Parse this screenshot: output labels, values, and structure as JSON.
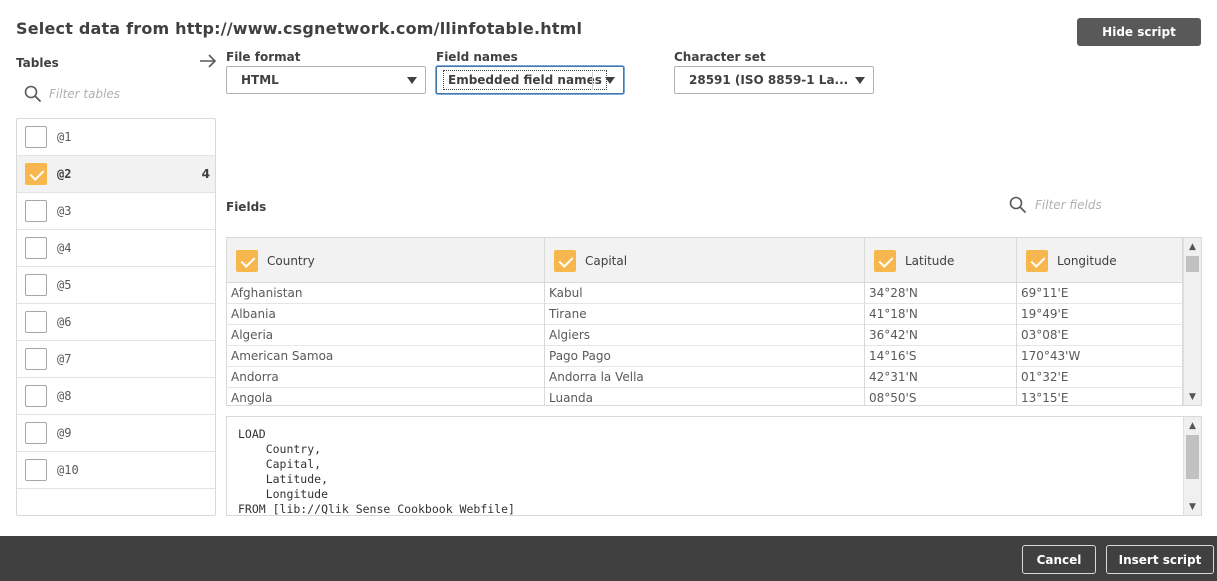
{
  "dialog": {
    "title": "Select data from http://www.csgnetwork.com/llinfotable.html",
    "hide_script_label": "Hide script"
  },
  "tables_panel": {
    "label": "Tables",
    "filter_placeholder": "Filter tables",
    "items": [
      {
        "name": "@1",
        "checked": false,
        "count": ""
      },
      {
        "name": "@2",
        "checked": true,
        "count": "4"
      },
      {
        "name": "@3",
        "checked": false,
        "count": ""
      },
      {
        "name": "@4",
        "checked": false,
        "count": ""
      },
      {
        "name": "@5",
        "checked": false,
        "count": ""
      },
      {
        "name": "@6",
        "checked": false,
        "count": ""
      },
      {
        "name": "@7",
        "checked": false,
        "count": ""
      },
      {
        "name": "@8",
        "checked": false,
        "count": ""
      },
      {
        "name": "@9",
        "checked": false,
        "count": ""
      },
      {
        "name": "@10",
        "checked": false,
        "count": ""
      }
    ]
  },
  "options": {
    "file_format": {
      "label": "File format",
      "value": "HTML"
    },
    "field_names": {
      "label": "Field names",
      "value": "Embedded field names"
    },
    "character_set": {
      "label": "Character set",
      "value": "28591 (ISO 8859-1 La..."
    }
  },
  "fields": {
    "label": "Fields",
    "filter_placeholder": "Filter fields",
    "columns": [
      {
        "name": "Country",
        "checked": true
      },
      {
        "name": "Capital",
        "checked": true
      },
      {
        "name": "Latitude",
        "checked": true
      },
      {
        "name": "Longitude",
        "checked": true
      }
    ],
    "rows": [
      [
        "Afghanistan",
        "Kabul",
        "34°28'N",
        "69°11'E"
      ],
      [
        "Albania",
        "Tirane",
        "41°18'N",
        "19°49'E"
      ],
      [
        "Algeria",
        "Algiers",
        "36°42'N",
        "03°08'E"
      ],
      [
        "American Samoa",
        "Pago Pago",
        "14°16'S",
        "170°43'W"
      ],
      [
        "Andorra",
        "Andorra la Vella",
        "42°31'N",
        "01°32'E"
      ],
      [
        "Angola",
        "Luanda",
        "08°50'S",
        "13°15'E"
      ]
    ]
  },
  "script": {
    "text": "LOAD\n    Country,\n    Capital,\n    Latitude,\n    Longitude\nFROM [lib://Qlik Sense Cookbook Webfile]"
  },
  "footer": {
    "cancel_label": "Cancel",
    "insert_label": "Insert script"
  },
  "colors": {
    "checkbox_checked": "#f8b74e",
    "footer_bg": "#404040",
    "hide_script_bg": "#595959"
  }
}
